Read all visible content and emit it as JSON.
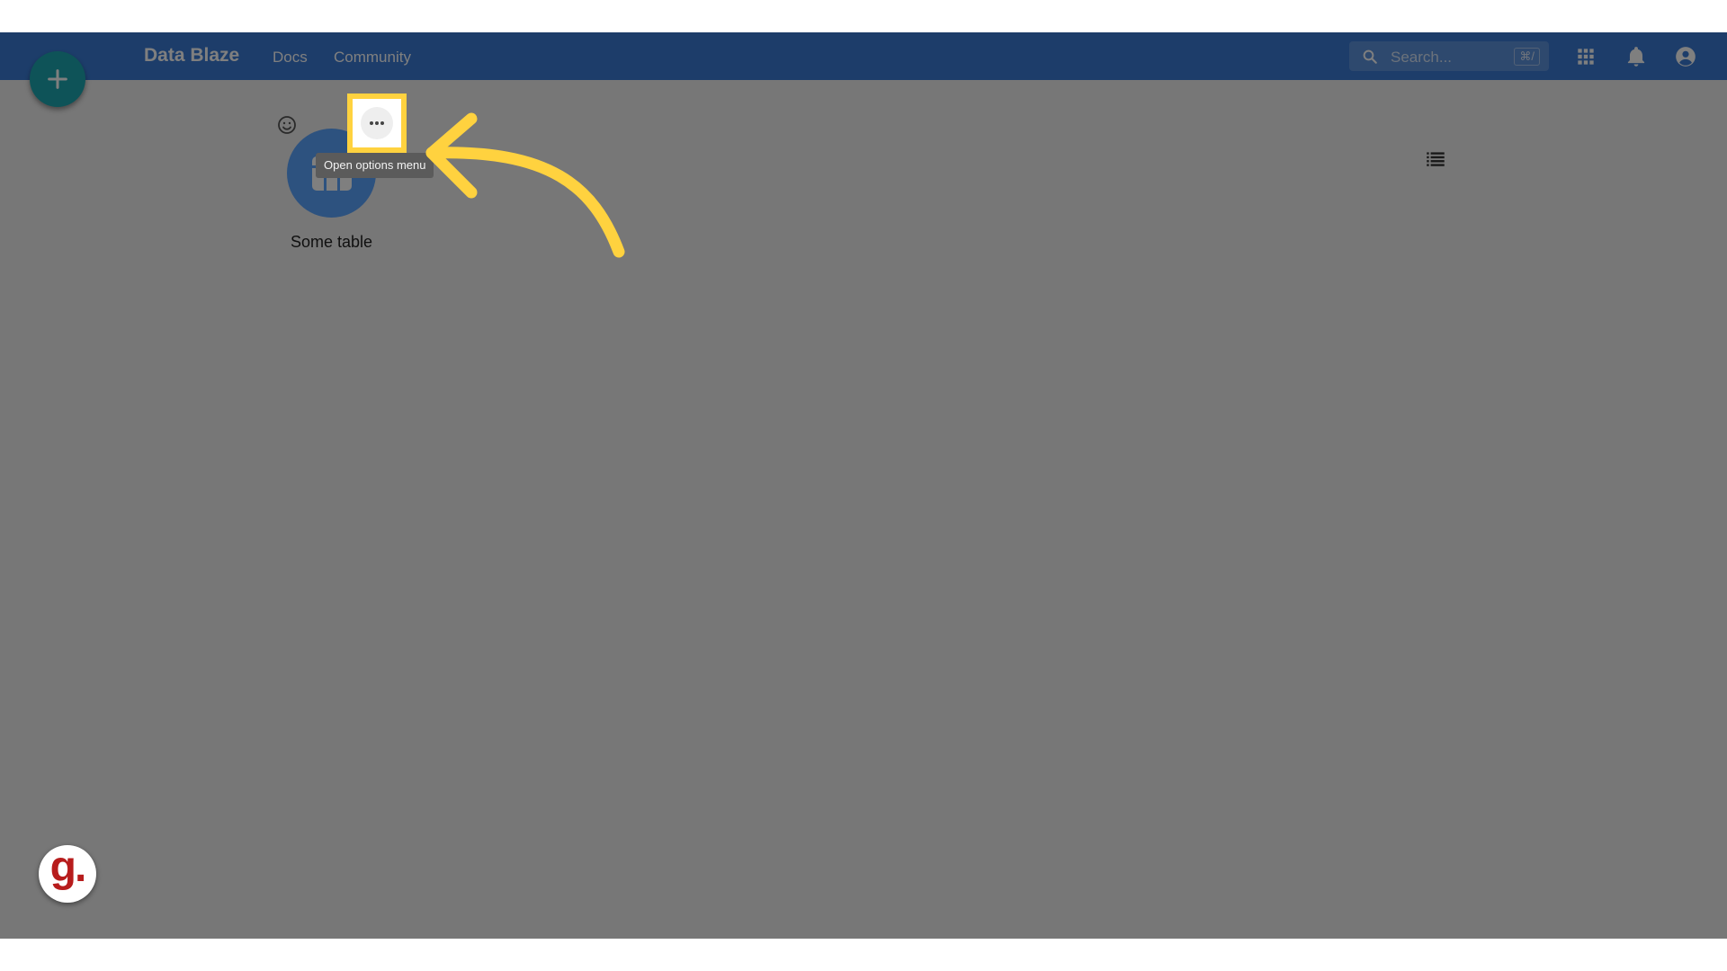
{
  "header": {
    "brand": "Data Blaze",
    "nav": {
      "docs": "Docs",
      "community": "Community"
    },
    "search": {
      "placeholder": "Search...",
      "shortcut": "⌘/"
    }
  },
  "colors": {
    "appbar": "#3a7bd5",
    "fab": "#1da7b0",
    "table_tile": "#5aa4ff",
    "highlight": "#ffd23f",
    "guidde_brand": "#b71c1c"
  },
  "workspace": {
    "tables": [
      {
        "name": "Some table",
        "icon": "table-icon"
      }
    ],
    "options_tooltip": "Open options menu"
  },
  "icons": {
    "fab": "plus-icon",
    "search": "search-icon",
    "apps": "apps-grid-icon",
    "notifications": "bell-icon",
    "account": "account-circle-icon",
    "emoji": "smiley-icon",
    "view": "list-view-icon",
    "options": "more-horizontal-icon",
    "annotation": "curved-arrow-icon"
  },
  "guidde": {
    "badge_letter": "g."
  }
}
